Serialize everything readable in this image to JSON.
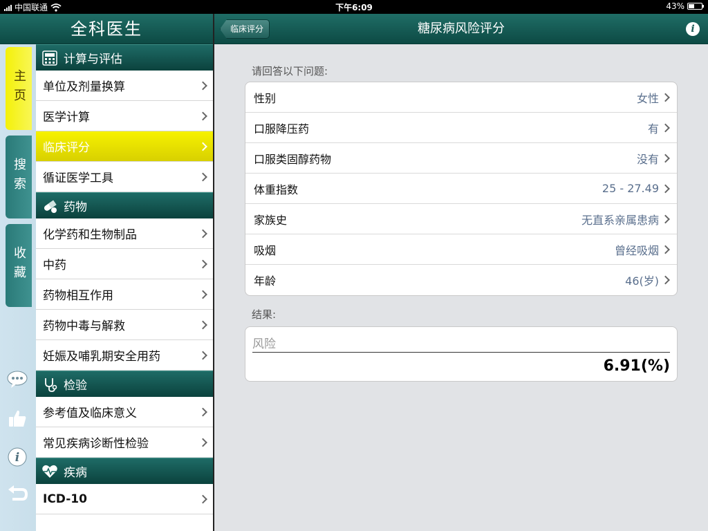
{
  "status_bar": {
    "carrier": "中国联通",
    "time": "下午6:09",
    "battery": "43%",
    "battery_level": 0.43
  },
  "left": {
    "title": "全科医生",
    "tabs": [
      {
        "label": "主页",
        "active": true
      },
      {
        "label": "搜索",
        "active": false
      },
      {
        "label": "收藏",
        "active": false
      }
    ],
    "bottom_icons": [
      "chat-icon",
      "thumbs-up-icon",
      "info-icon",
      "undo-icon"
    ],
    "sections": [
      {
        "title": "计算与评估",
        "icon": "calculator-icon",
        "items": [
          "单位及剂量换算",
          "医学计算",
          "临床评分",
          "循证医学工具"
        ]
      },
      {
        "title": "药物",
        "icon": "pill-icon",
        "items": [
          "化学药和生物制品",
          "中药",
          "药物相互作用",
          "药物中毒与解救",
          "妊娠及哺乳期安全用药"
        ]
      },
      {
        "title": "检验",
        "icon": "stethoscope-icon",
        "items": [
          "参考值及临床意义",
          "常见疾病诊断性检验"
        ]
      },
      {
        "title": "疾病",
        "icon": "heartbeat-icon",
        "items": [
          "ICD-10"
        ]
      }
    ],
    "selected_item": "临床评分"
  },
  "right": {
    "back_label": "临床评分",
    "title": "糖尿病风险评分",
    "questions_label": "请回答以下问题:",
    "questions": [
      {
        "label": "性别",
        "value": "女性"
      },
      {
        "label": "口服降压药",
        "value": "有"
      },
      {
        "label": "口服类固醇药物",
        "value": "没有"
      },
      {
        "label": "体重指数",
        "value": "25 - 27.49"
      },
      {
        "label": "家族史",
        "value": "无直系亲属患病"
      },
      {
        "label": "吸烟",
        "value": "曾经吸烟"
      },
      {
        "label": "年龄",
        "value": "46(岁)"
      }
    ],
    "result_label": "结果:",
    "result_field_label": "风险",
    "result_value": "6.91(%)"
  },
  "colors": {
    "header_green": "#0d4a44",
    "selected_yellow": "#f4f10a",
    "value_blue": "#5a6f8d"
  }
}
